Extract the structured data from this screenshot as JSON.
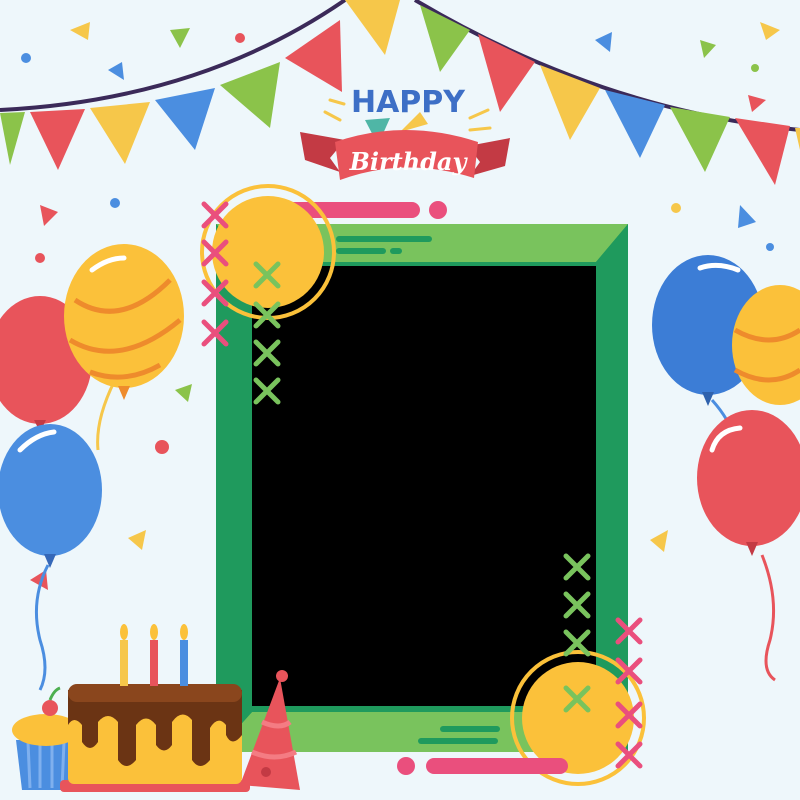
{
  "banner": {
    "happy_text": "HAPPY",
    "birthday_text": "Birthday"
  },
  "colors": {
    "background": "#eef7fb",
    "frame_green_outer": "#1f9a5d",
    "frame_green_inner": "#79c35d",
    "photo_area": "#000000",
    "ribbon_red": "#e8545b",
    "ribbon_dark": "#c33a44",
    "text_blue": "#3d6fc6",
    "pink": "#ea4f7d",
    "yellow": "#fbc13a",
    "bunting_line": "#3b2a59"
  },
  "icons": {
    "bunting": "bunting-flags-icon",
    "party_hat": "party-hat-icon",
    "cake": "birthday-cake-icon",
    "cupcake": "cupcake-icon",
    "balloon": "balloon-icon",
    "photo_placeholder": "photo-placeholder"
  }
}
